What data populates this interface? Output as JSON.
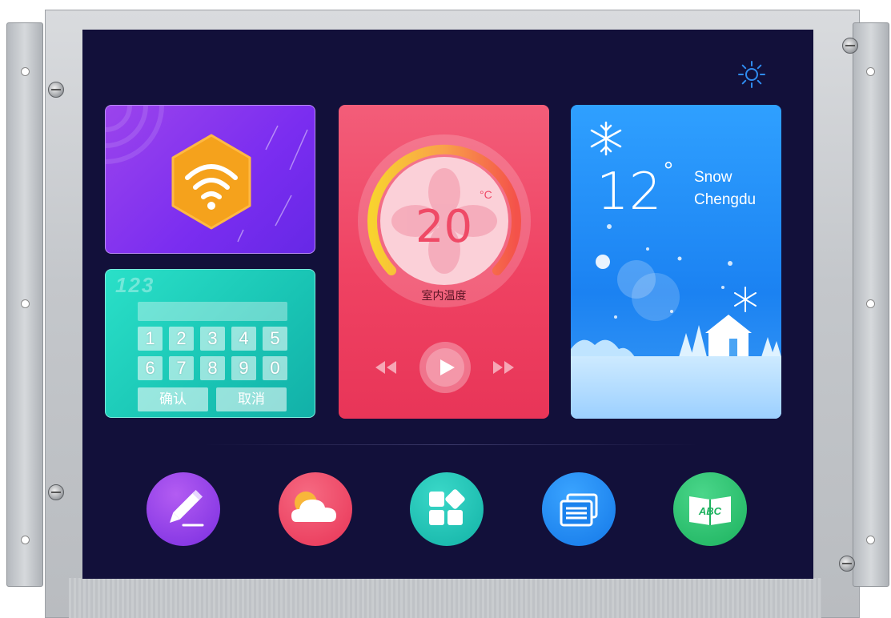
{
  "keypad": {
    "display": "123",
    "keys": [
      "1",
      "2",
      "3",
      "4",
      "5",
      "6",
      "7",
      "8",
      "9",
      "0"
    ],
    "confirm_label": "确认",
    "cancel_label": "取消"
  },
  "thermostat": {
    "value": "20",
    "unit": "°C",
    "label": "室内温度"
  },
  "weather": {
    "temperature": "12",
    "degree": "°",
    "condition": "Snow",
    "city": "Chengdu"
  },
  "icons": [
    "settings-sun-icon",
    "wifi-icon",
    "pen-icon",
    "weather-cloud-icon",
    "apps-grid-icon",
    "document-list-icon",
    "abc-book-icon"
  ],
  "colors": {
    "screen_bg": "#12103a",
    "wifi_card": "#7a2df0",
    "keypad_card": "#19c4b4",
    "thermostat_card": "#ef4262",
    "weather_card": "#1b82f2",
    "pen_button": "#8b3ee8",
    "cloud_button": "#ef4262",
    "apps_button": "#18bfb3",
    "docs_button": "#1f8cf0",
    "book_button": "#25c06a"
  }
}
